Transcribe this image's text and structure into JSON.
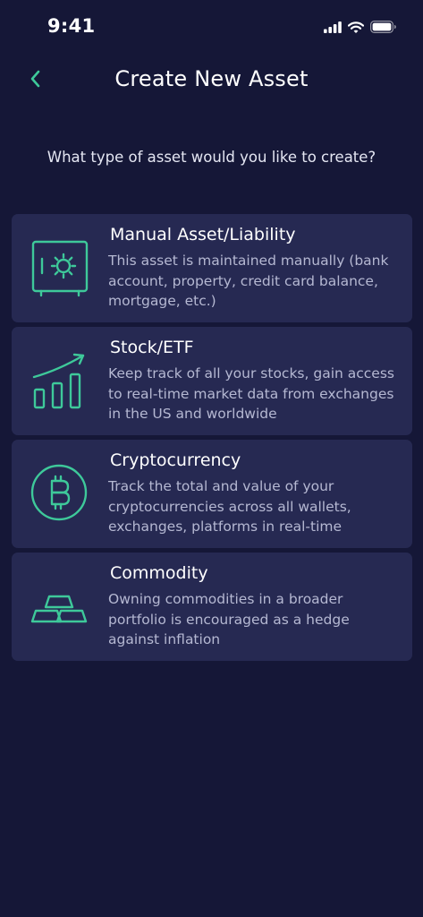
{
  "status_bar": {
    "time": "9:41",
    "icons": [
      "cellular-signal-icon",
      "wifi-icon",
      "battery-icon"
    ]
  },
  "header": {
    "back_icon": "chevron-left-icon",
    "title": "Create New Asset"
  },
  "prompt": "What type of asset would you like to create?",
  "colors": {
    "background": "#151737",
    "card": "#262952",
    "accent": "#3ec99a"
  },
  "asset_types": [
    {
      "icon": "safe-icon",
      "title": "Manual Asset/Liability",
      "description": "This asset is maintained manually (bank account, property, credit card balance, mortgage, etc.)"
    },
    {
      "icon": "growth-chart-icon",
      "title": "Stock/ETF",
      "description": "Keep track of all your stocks, gain access to real-time market data from exchanges in the US and worldwide"
    },
    {
      "icon": "bitcoin-icon",
      "title": "Cryptocurrency",
      "description": "Track the total and value of your cryptocurrencies across all wallets, exchanges, platforms in real-time"
    },
    {
      "icon": "gold-bars-icon",
      "title": "Commodity",
      "description": "Owning commodities in a broader portfolio is encouraged as a hedge against inflation"
    }
  ]
}
